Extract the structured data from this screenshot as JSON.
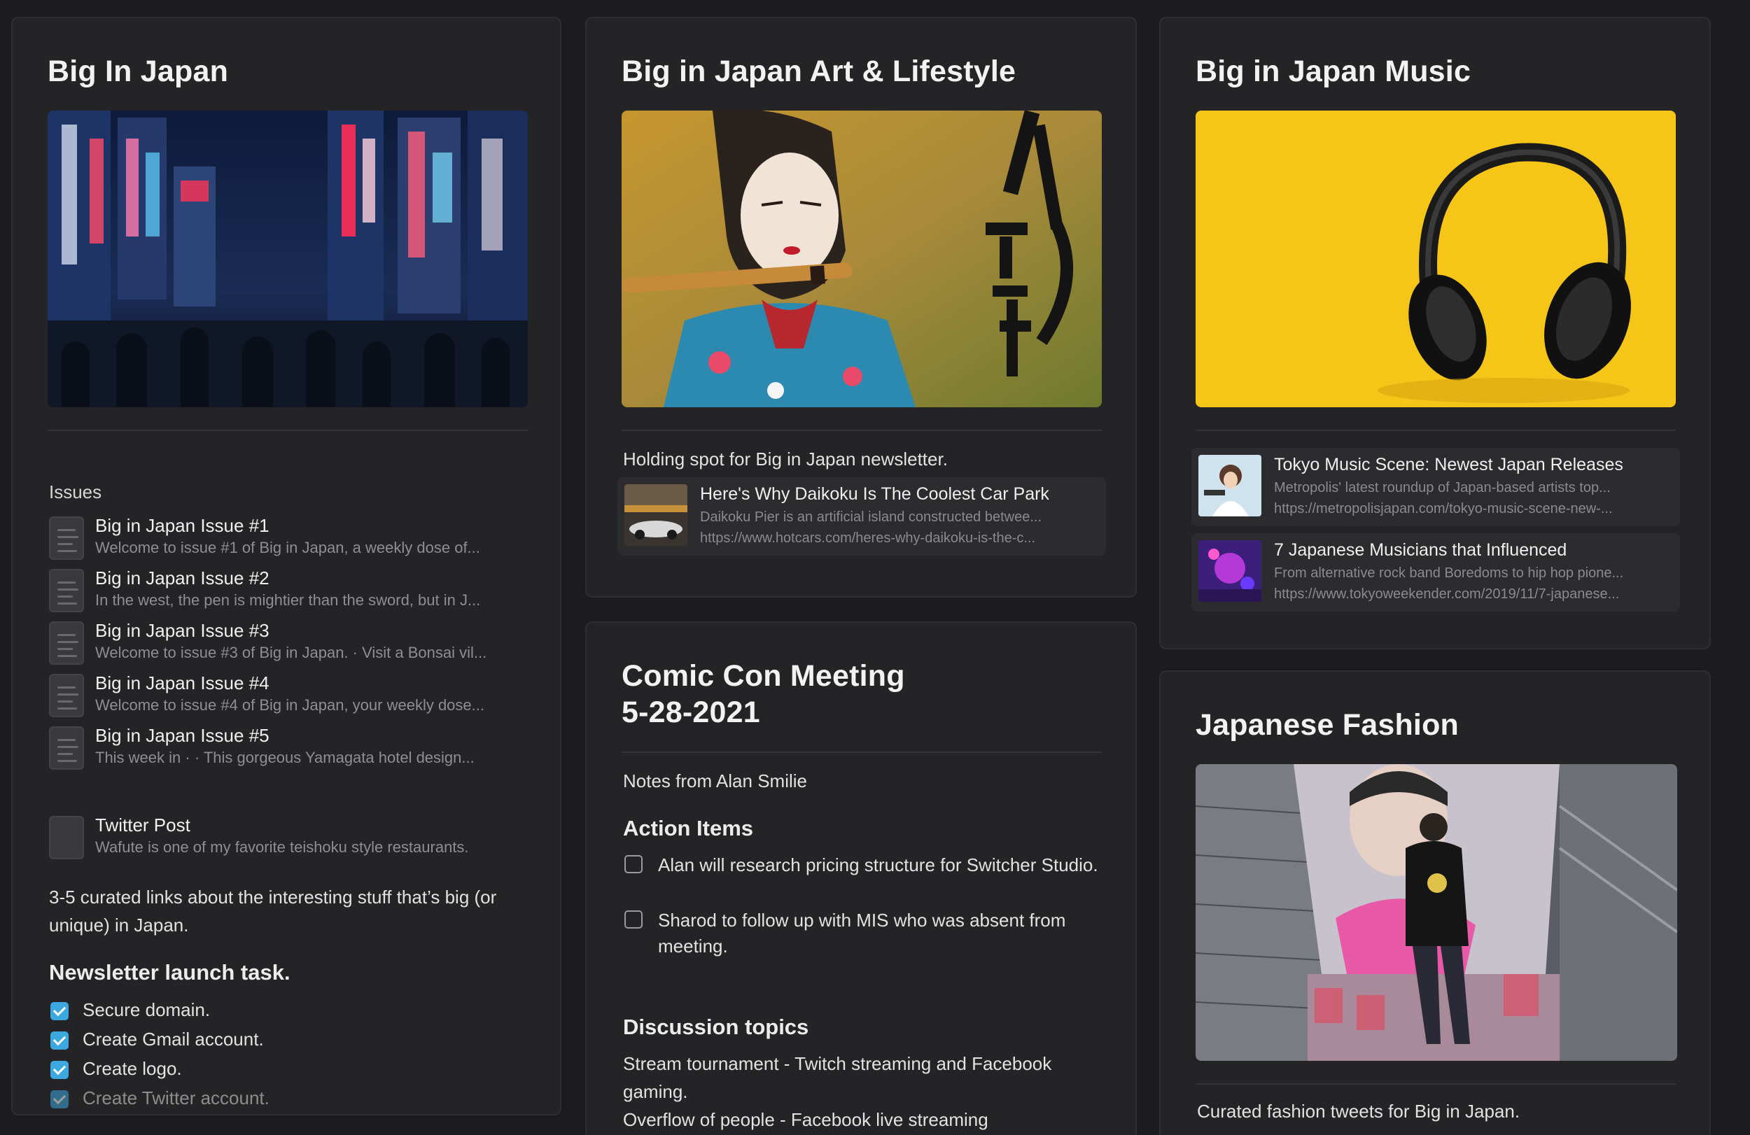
{
  "cards": {
    "big_in_japan": {
      "title": "Big In Japan",
      "issues_label": "Issues",
      "issues": [
        {
          "title": "Big in Japan Issue #1",
          "sub": "Welcome to issue #1 of Big in Japan, a weekly dose of..."
        },
        {
          "title": "Big in Japan Issue #2",
          "sub": "In the west, the pen is mightier than the sword, but in J..."
        },
        {
          "title": "Big in Japan Issue #3",
          "sub": "Welcome to issue #3 of Big in Japan. · Visit a Bonsai vil..."
        },
        {
          "title": "Big in Japan Issue #4",
          "sub": "Welcome to issue #4 of Big in Japan, your weekly dose..."
        },
        {
          "title": "Big in Japan Issue #5",
          "sub": "This week in  ·  · This gorgeous Yamagata hotel design..."
        }
      ],
      "twitter": {
        "title": "Twitter Post",
        "sub": "Wafute is one of my favorite teishoku style restaurants."
      },
      "description": "3-5 curated links about the interesting stuff that’s big (or unique) in Japan.",
      "tasks_heading": "Newsletter launch task.",
      "tasks": [
        {
          "label": "Secure domain.",
          "checked": true
        },
        {
          "label": "Create Gmail account.",
          "checked": true
        },
        {
          "label": "Create logo.",
          "checked": true
        },
        {
          "label": "Create Twitter account.",
          "checked": true
        }
      ]
    },
    "art_lifestyle": {
      "title": "Big in Japan Art & Lifestyle",
      "description": "Holding spot for Big in Japan newsletter.",
      "link": {
        "title": "Here's Why Daikoku Is The Coolest Car Park",
        "desc": "Daikoku Pier is an artificial island constructed betwee...",
        "url": "https://www.hotcars.com/heres-why-daikoku-is-the-c..."
      }
    },
    "comic_con": {
      "title_line1": "Comic Con Meeting",
      "title_line2": "5-28-2021",
      "notes": "Notes from Alan Smilie",
      "action_heading": "Action Items",
      "actions": [
        {
          "label": "Alan will research pricing structure for Switcher Studio.",
          "checked": false
        },
        {
          "label": "Sharod to follow up with MIS who was absent from meeting.",
          "checked": false
        }
      ],
      "discussion_heading": "Discussion topics",
      "discussion": [
        "Stream tournament - Twitch streaming and Facebook gaming.",
        "Overflow of people - Facebook live streaming"
      ]
    },
    "music": {
      "title": "Big in Japan Music",
      "links": [
        {
          "title": "Tokyo Music Scene: Newest Japan Releases",
          "desc": "Metropolis' latest roundup of Japan-based artists top...",
          "url": "https://metropolisjapan.com/tokyo-music-scene-new-..."
        },
        {
          "title": "7 Japanese Musicians that Influenced",
          "desc": "From alternative rock band Boredoms to hip hop pione...",
          "url": "https://www.tokyoweekender.com/2019/11/7-japanese..."
        }
      ]
    },
    "fashion": {
      "title": "Japanese Fashion",
      "description": "Curated fashion tweets for Big in Japan."
    }
  },
  "colors": {
    "background": "#1c1c1e",
    "card": "#242426",
    "checkbox_checked": "#3da8e0",
    "music_hero": "#f5c518"
  }
}
